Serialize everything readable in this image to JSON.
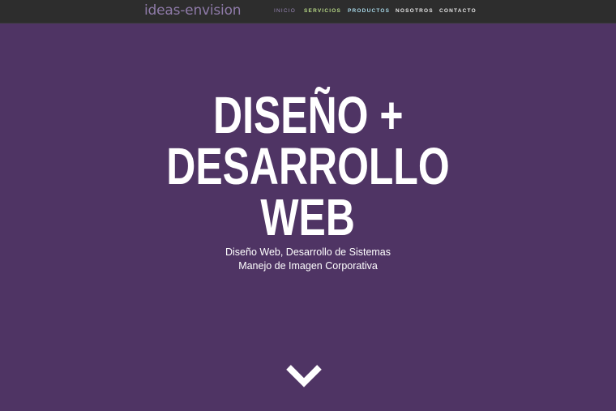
{
  "header": {
    "logo": "ideas-envision",
    "nav": [
      "INICIO",
      "SERVICIOS",
      "PRODUCTOS",
      "NOSOTROS",
      "CONTACTO"
    ]
  },
  "hero": {
    "headline_lines": [
      "DISEÑO +",
      "DESARROLLO",
      "WEB"
    ],
    "subtitle_lines": [
      "Diseño Web, Desarrollo de Sistemas",
      "Manejo de Imagen Corporativa"
    ],
    "scroll_icon": "chevron-down-icon"
  },
  "colors": {
    "background": "#4f3464",
    "navbar": "#2d2d2d",
    "logo": "#8e7aa8",
    "nav_active": "#9a88b8",
    "nav_servicios": "#b7d886",
    "nav_productos": "#a7d8e8",
    "nav_default": "#e6e6e6",
    "text": "#ffffff"
  }
}
